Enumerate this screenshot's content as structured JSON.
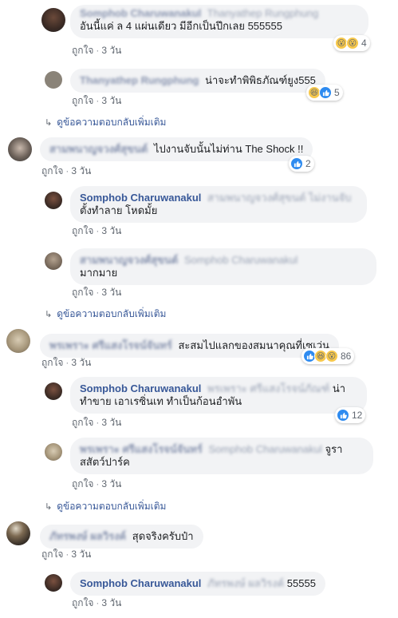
{
  "labels": {
    "like": "ถูกใจ",
    "time": "3 วัน",
    "more_replies": "ดูข้อความตอบกลับเพิ่มเติม"
  },
  "comments": [
    {
      "author": "Somphob Charuwanakul",
      "tag": "Thanyathep Rungphung",
      "text": "อันนี้แค่ ล 4 แผ่นเดียว มีอีกเป็นปึกเลย 555555",
      "reactions": [
        "wow",
        "wow"
      ],
      "count": "4"
    },
    {
      "author": "Thanyathep Rungphung",
      "tag": "",
      "text": "น่าจะทำพิพิธภัณฑ์ยูง555",
      "reactions": [
        "haha",
        "like"
      ],
      "count": "5"
    },
    {
      "author": "สามพนาญจวงศ์สุขนต์",
      "tag": "",
      "text": "ไปงานจับนั้นไม่ท่าน The Shock !!",
      "reactions": [
        "like"
      ],
      "count": "2"
    },
    {
      "author": "Somphob Charuwanakul",
      "tag": "สามพนาญจวงศ์สุขนต์ ไม่งานจับ",
      "text": "ตั้งทำลาย โหดมั้ย",
      "reactions": [],
      "count": ""
    },
    {
      "author": "สามพนาญจวงศ์สุขนต์",
      "tag": "Somphob Charuwanakul",
      "text": "มากมาย",
      "reactions": [],
      "count": ""
    },
    {
      "author": "พรเพราะ ศรีแสงโรจน์จันทร์",
      "tag": "",
      "text": "สะสมไปแลกของสมนาคุณที่เซเว่น",
      "reactions": [
        "like",
        "haha",
        "wow"
      ],
      "count": "86"
    },
    {
      "author": "Somphob Charuwanakul",
      "tag": "พรเพราะ ศรีแสงโรจน์ภัณฑ์",
      "text": "ทำขาย เอาเรซิ่นเท ทำเป็นก้อนอำพัน",
      "text_lead": "น่า",
      "reactions": [
        "like"
      ],
      "count": "12"
    },
    {
      "author": "พรเพราะ ศรีแสงโรจน์จันทร์",
      "tag": "Somphob Charuwanakul",
      "text": "สสัตว์ปาร์ค",
      "text_lead": "จูรา",
      "reactions": [],
      "count": ""
    },
    {
      "author": "ภัทรพงษ์ ผลวิรงค์",
      "tag": "",
      "text": "สุดจริงครับป๋า",
      "reactions": [],
      "count": ""
    },
    {
      "author": "Somphob Charuwanakul",
      "tag": "ภัทรพงษ์ ผลวิรงค์",
      "text": "55555",
      "reactions": [],
      "count": ""
    }
  ],
  "colors": {
    "link": "#385898",
    "bubble": "#f2f3f5",
    "like_blue": "#2e8bf0",
    "emoji_yellow": "#f7c84b"
  }
}
